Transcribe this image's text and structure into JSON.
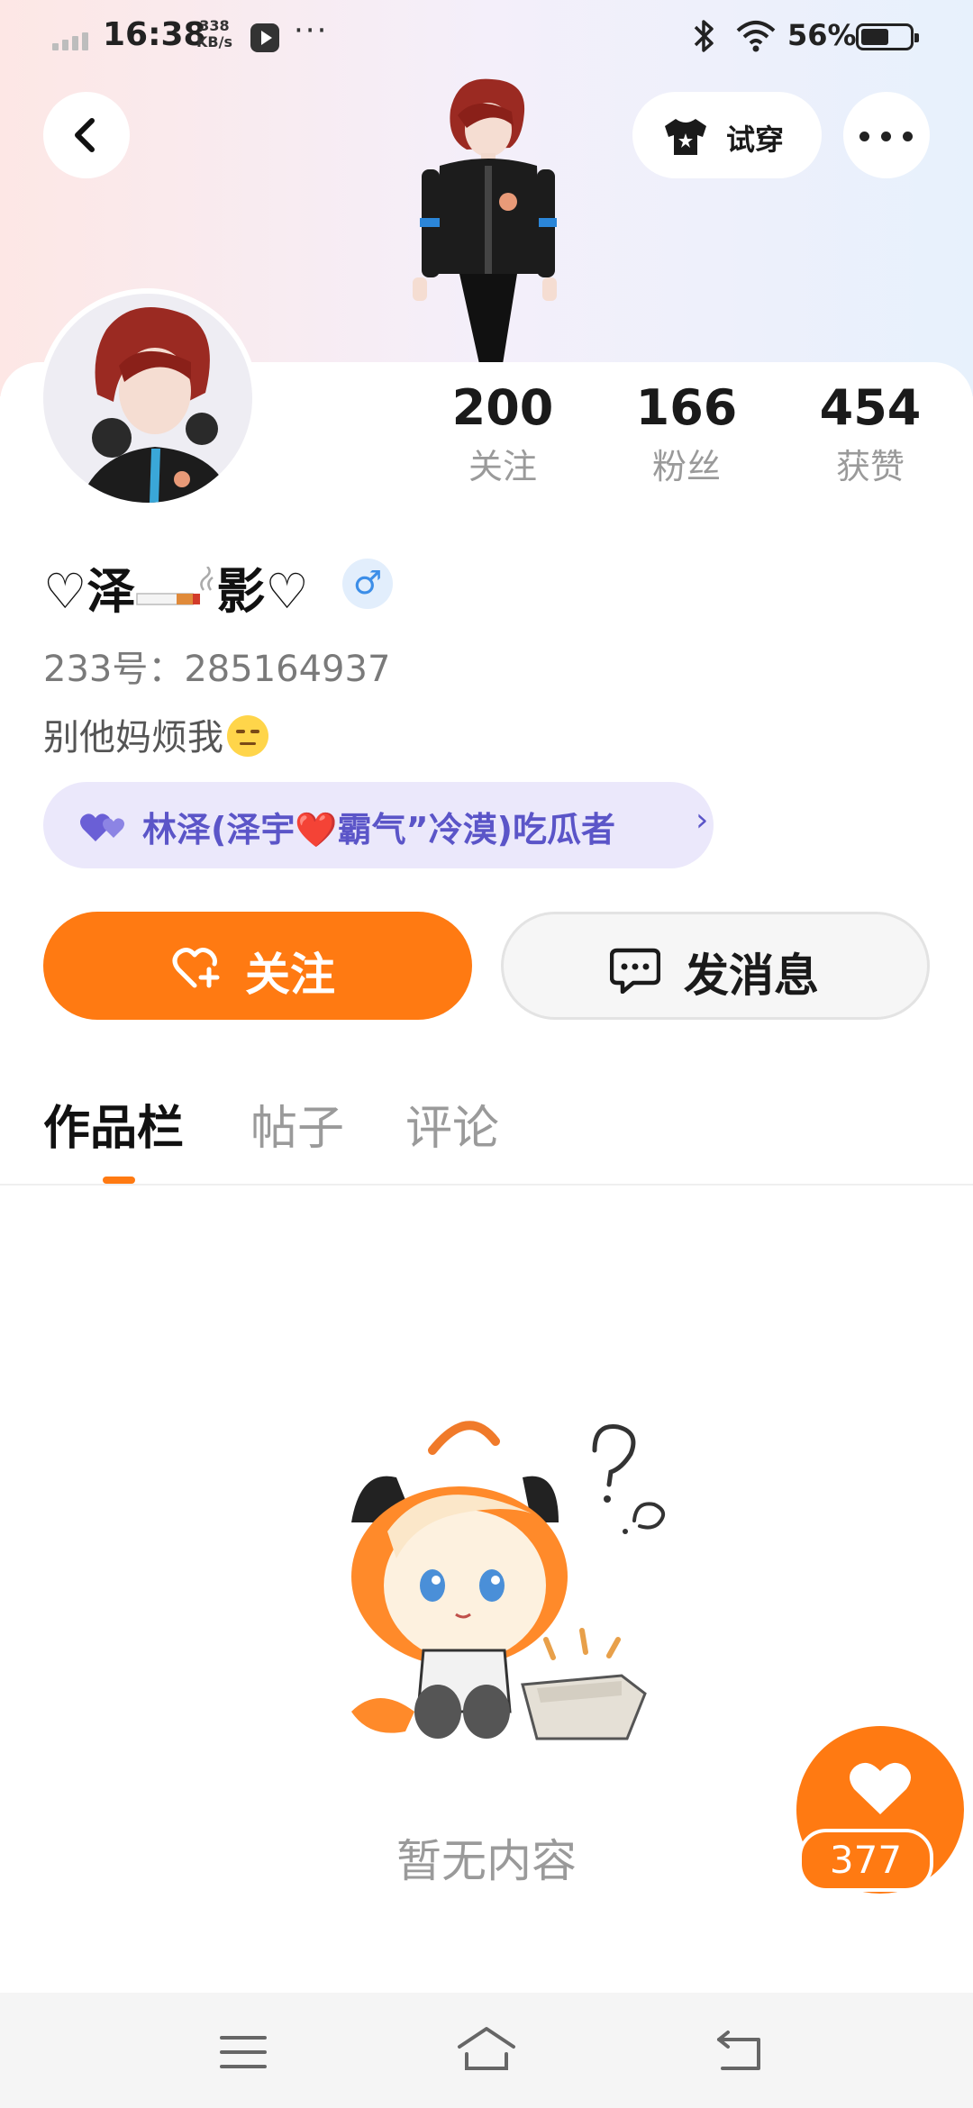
{
  "status_bar": {
    "time": "16:38",
    "network_speed_value": "338",
    "network_speed_unit": "KB/s",
    "overflow": "···",
    "battery": "56%"
  },
  "header": {
    "tryon_label": "试穿"
  },
  "profile": {
    "stats": [
      {
        "value": "200",
        "label": "关注"
      },
      {
        "value": "166",
        "label": "粉丝"
      },
      {
        "value": "454",
        "label": "获赞"
      }
    ],
    "username_left": "♡泽",
    "username_right": "影♡",
    "gender": "♂",
    "user_id": "233号：285164937",
    "bio": "别他妈烦我",
    "relation": "林泽(泽宇❤️霸气”冷漠)吃瓜者",
    "relation_chevron": "›"
  },
  "actions": {
    "follow_label": "关注",
    "message_label": "发消息"
  },
  "tabs": [
    {
      "label": "作品栏",
      "active": true
    },
    {
      "label": "帖子",
      "active": false
    },
    {
      "label": "评论",
      "active": false
    }
  ],
  "empty_state": {
    "text": "暂无内容"
  },
  "like_fab": {
    "count": "377"
  },
  "colors": {
    "accent": "#ff7a12",
    "relation_bg": "#ebe8fb",
    "relation_text": "#5b55c8",
    "gender_badge": "#3c8ee8"
  },
  "icons": [
    "back-arrow-icon",
    "shirt-icon",
    "more-icon",
    "heart-icon",
    "chat-bubble-icon",
    "add-heart-icon",
    "bluetooth-icon",
    "wifi-icon",
    "battery-icon",
    "menu-icon",
    "home-icon",
    "return-icon"
  ]
}
